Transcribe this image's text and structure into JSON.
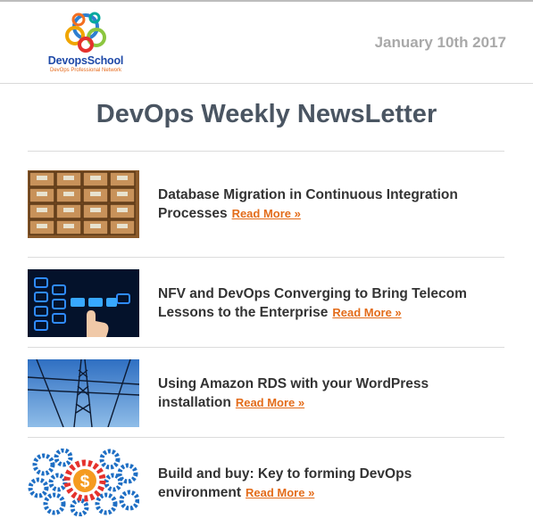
{
  "header": {
    "logo_name": "DevopsSchool",
    "logo_tagline": "DevOps Professional Network",
    "date": "January 10th 2017"
  },
  "newsletter": {
    "title": "DevOps Weekly NewsLetter"
  },
  "articles": [
    {
      "title": "Database Migration in Continuous Integration Processes",
      "link": "Read More »",
      "thumbnail_icon": "card-catalog-drawers"
    },
    {
      "title": "NFV and DevOps Converging to Bring Telecom Lessons to the Enterprise",
      "link": "Read More »",
      "thumbnail_icon": "touchscreen-finger"
    },
    {
      "title": "Using Amazon RDS with your WordPress installation",
      "link": "Read More »",
      "thumbnail_icon": "power-pylon"
    },
    {
      "title": "Build and buy: Key to forming DevOps environment",
      "link": "Read More »",
      "thumbnail_icon": "gears-dollar"
    }
  ],
  "colors": {
    "accent_link": "#e36c1a",
    "title": "#4a5562",
    "date": "#a9a9a9"
  }
}
